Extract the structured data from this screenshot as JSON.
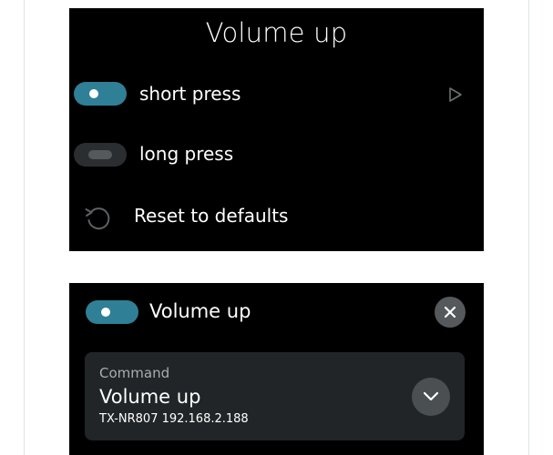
{
  "top_panel": {
    "title": "Volume up",
    "short_press": {
      "label": "short press",
      "enabled": true
    },
    "long_press": {
      "label": "long press",
      "enabled": false
    },
    "reset": {
      "label": "Reset to defaults"
    }
  },
  "bottom_panel": {
    "title": "Volume up",
    "enabled": true,
    "command": {
      "caption": "Command",
      "value": "Volume up",
      "device": "TX-NR807 192.168.2.188"
    }
  },
  "colors": {
    "toggle_on": "#2f7f96",
    "toggle_off": "#2b2e30",
    "panel_bg": "#000000",
    "card_bg": "#222527"
  },
  "icons": [
    "play-icon",
    "reset-icon",
    "close-icon",
    "chevron-down-icon"
  ]
}
